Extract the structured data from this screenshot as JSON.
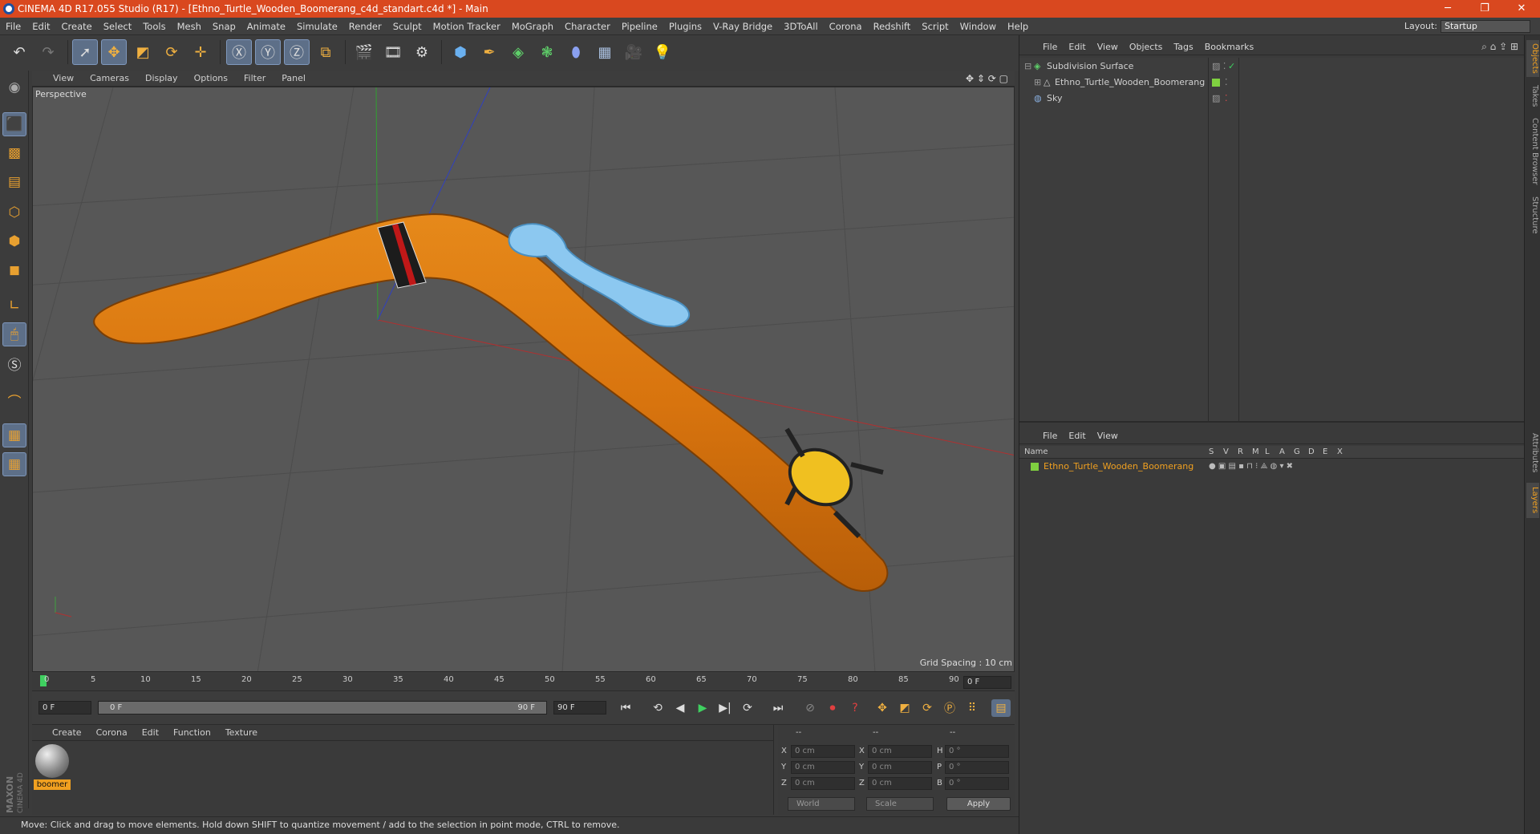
{
  "window": {
    "title": "CINEMA 4D R17.055 Studio (R17) - [Ethno_Turtle_Wooden_Boomerang_c4d_standart.c4d *] - Main",
    "minimize": "─",
    "maximize": "❐",
    "close": "✕"
  },
  "menubar": {
    "items": [
      "File",
      "Edit",
      "Create",
      "Select",
      "Tools",
      "Mesh",
      "Snap",
      "Animate",
      "Simulate",
      "Render",
      "Sculpt",
      "Motion Tracker",
      "MoGraph",
      "Character",
      "Pipeline",
      "Plugins",
      "V-Ray Bridge",
      "3DToAll",
      "Corona",
      "Redshift",
      "Script",
      "Window",
      "Help"
    ],
    "layout_label": "Layout:",
    "layout_value": "Startup"
  },
  "viewport": {
    "menu": [
      "View",
      "Cameras",
      "Display",
      "Options",
      "Filter",
      "Panel"
    ],
    "camera_label": "Perspective",
    "grid_spacing": "Grid Spacing : 10 cm"
  },
  "timeline": {
    "ticks": [
      "0",
      "5",
      "10",
      "15",
      "20",
      "25",
      "30",
      "35",
      "40",
      "45",
      "50",
      "55",
      "60",
      "65",
      "70",
      "75",
      "80",
      "85",
      "90"
    ],
    "current_frame": "0 F",
    "start_field": "0 F",
    "range_start": "0 F",
    "range_end": "90 F",
    "end_field": "90 F"
  },
  "material_panel": {
    "menu": [
      "Create",
      "Corona",
      "Edit",
      "Function",
      "Texture"
    ],
    "material_name": "boomer"
  },
  "coordinates": {
    "headers": [
      "--",
      "--",
      "--"
    ],
    "pos_labels": [
      "X",
      "Y",
      "Z"
    ],
    "size_labels": [
      "X",
      "Y",
      "Z"
    ],
    "rot_labels": [
      "H",
      "P",
      "B"
    ],
    "pos_values": [
      "0 cm",
      "0 cm",
      "0 cm"
    ],
    "size_values": [
      "0 cm",
      "0 cm",
      "0 cm"
    ],
    "rot_values": [
      "0 °",
      "0 °",
      "0 °"
    ],
    "mode_select": "World",
    "scale_select": "Scale",
    "apply": "Apply"
  },
  "status": {
    "text": "Move: Click and drag to move elements. Hold down SHIFT to quantize movement / add to the selection in point mode, CTRL to remove."
  },
  "objects_panel": {
    "menu": [
      "File",
      "Edit",
      "View",
      "Objects",
      "Tags",
      "Bookmarks"
    ],
    "objects": [
      {
        "name": "Subdivision Surface"
      },
      {
        "name": "Ethno_Turtle_Wooden_Boomerang"
      },
      {
        "name": "Sky"
      }
    ]
  },
  "layers_panel": {
    "menu": [
      "File",
      "Edit",
      "View"
    ],
    "columns": [
      "Name",
      "S",
      "V",
      "R",
      "M",
      "L",
      "A",
      "G",
      "D",
      "E",
      "X"
    ],
    "layers": [
      {
        "name": "Ethno_Turtle_Wooden_Boomerang"
      }
    ]
  },
  "side_tabs": [
    "Objects",
    "Takes",
    "Content Browser",
    "Structure",
    "Attributes",
    "Layers"
  ],
  "branding": {
    "logo_text": "MAXON CINEMA 4D"
  },
  "colors": {
    "titlebar": "#d9481f",
    "accent": "#f0a020",
    "boomerang": "#d9770f"
  }
}
